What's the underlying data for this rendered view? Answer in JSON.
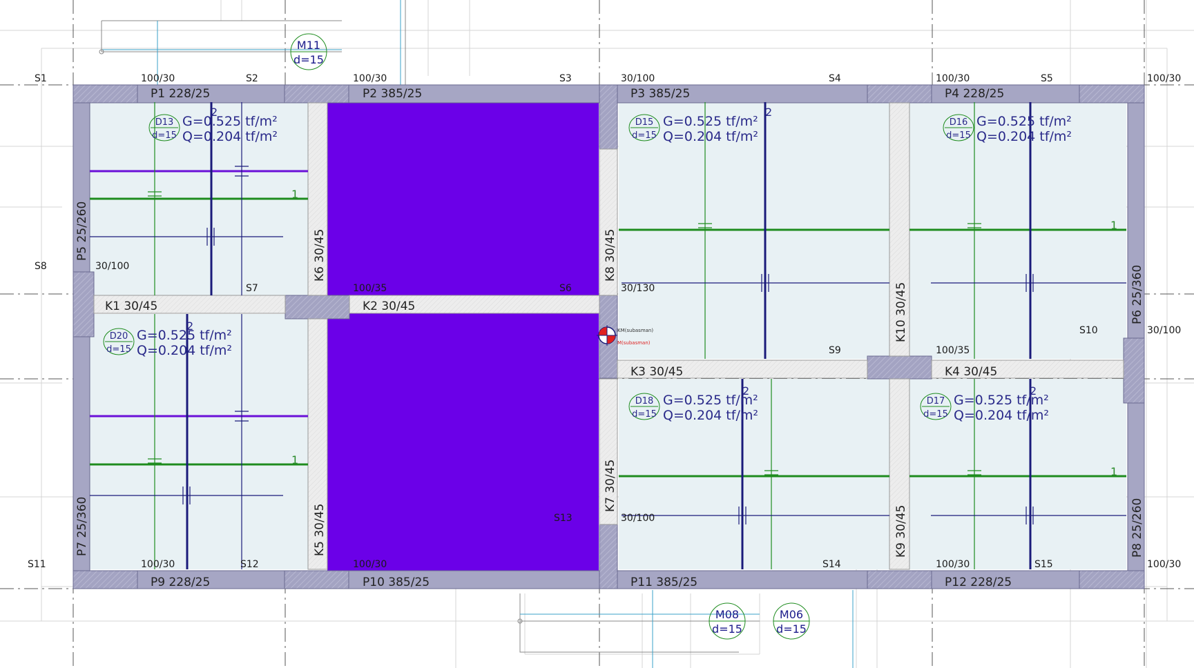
{
  "sections": {
    "S1": "S1",
    "S2": "S2",
    "S3": "S3",
    "S4": "S4",
    "S5": "S5",
    "S6": "S6",
    "S7": "S7",
    "S8": "S8",
    "S9": "S9",
    "S10": "S10",
    "S11": "S11",
    "S12": "S12",
    "S13": "S13",
    "S14": "S14",
    "S15": "S15"
  },
  "dims": {
    "top1": "100/30",
    "top2": "100/30",
    "top3": "30/100",
    "top4": "100/30",
    "top5": "100/30",
    "left30_100": "30/100",
    "right30_100": "30/100",
    "mid100_35": "100/35",
    "mid30_130": "30/130",
    "mid100_35b": "100/35",
    "low30_100": "30/100",
    "bot1": "100/30",
    "bot2": "100/30",
    "bot3": "100/30",
    "bot4": "100/30"
  },
  "elements": {
    "P1": "P1   228/25",
    "P2": "P2   385/25",
    "P3": "P3   385/25",
    "P4": "P4   228/25",
    "P9": "P9   228/25",
    "P10": "P10   385/25",
    "P11": "P11   385/25",
    "P12": "P12   228/25",
    "P5": "P5   25/260",
    "P6": "P6   25/360",
    "P7": "P7   25/360",
    "P8": "P8   25/260",
    "K1": "K1   30/45",
    "K2": "K2   30/45",
    "K3": "K3   30/45",
    "K4": "K4   30/45",
    "K5": "K5   30/45",
    "K6": "K6   30/45",
    "K7": "K7   30/45",
    "K8": "K8   30/45",
    "K9": "K9   30/45",
    "K10": "K10   30/45"
  },
  "slabs": [
    {
      "id": "D13",
      "d": "d=15",
      "g": "G=0.525 tf/m²",
      "q": "Q=0.204 tf/m²"
    },
    {
      "id": "D15",
      "d": "d=15",
      "g": "G=0.525 tf/m²",
      "q": "Q=0.204 tf/m²"
    },
    {
      "id": "D16",
      "d": "d=15",
      "g": "G=0.525 tf/m²",
      "q": "Q=0.204 tf/m²"
    },
    {
      "id": "D20",
      "d": "d=15",
      "g": "G=0.525 tf/m²",
      "q": "Q=0.204 tf/m²"
    },
    {
      "id": "D18",
      "d": "d=15",
      "g": "G=0.525 tf/m²",
      "q": "Q=0.204 tf/m²"
    },
    {
      "id": "D17",
      "d": "d=15",
      "g": "G=0.525 tf/m²",
      "q": "Q=0.204 tf/m²"
    }
  ],
  "mats": [
    {
      "id": "M11",
      "d": "d=15"
    },
    {
      "id": "M08",
      "d": "d=15"
    },
    {
      "id": "M06",
      "d": "d=15"
    }
  ],
  "markers": {
    "one": "1",
    "two": "2"
  },
  "center_marker": {
    "km": "KM(subasman)",
    "m": "M(subasman)"
  },
  "colors": {
    "slab_fill": "#e8f1f4",
    "void_fill": "#6b00e8",
    "wall_fill": "#9a9ab8",
    "beam_fill": "#ececec",
    "green_line": "#1e8c1e",
    "navy_line": "#1a1a7a",
    "purple_line": "#6a10d8"
  }
}
